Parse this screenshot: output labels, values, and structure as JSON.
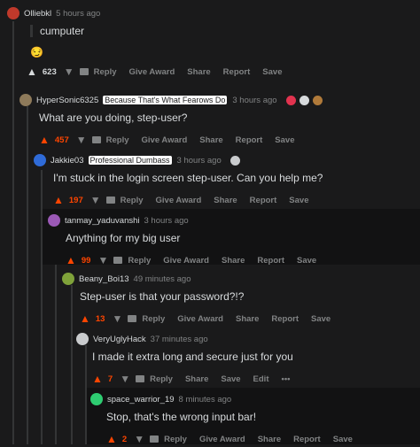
{
  "comments": [
    {
      "user": "Olliebkl",
      "time": "5 hours ago",
      "quote": "cumputer",
      "emoji": "😏",
      "score": "623",
      "actions": [
        "Reply",
        "Give Award",
        "Share",
        "Report",
        "Save"
      ]
    },
    {
      "user": "HyperSonic6325",
      "flair": "Because That's What Fearows Do",
      "time": "3 hours ago",
      "body": "What are you doing, step-user?",
      "score": "457",
      "actions": [
        "Reply",
        "Give Award",
        "Share",
        "Report",
        "Save"
      ]
    },
    {
      "user": "Jakkie03",
      "flair": "Professional Dumbass",
      "time": "3 hours ago",
      "body": "I'm stuck in the login screen step-user. Can you help me?",
      "score": "197",
      "actions": [
        "Reply",
        "Give Award",
        "Share",
        "Report",
        "Save"
      ]
    },
    {
      "user": "tanmay_yaduvanshi",
      "time": "3 hours ago",
      "body": "Anything for my big user",
      "score": "99",
      "actions": [
        "Reply",
        "Give Award",
        "Share",
        "Report",
        "Save"
      ]
    },
    {
      "user": "Beany_Boi13",
      "time": "49 minutes ago",
      "body": "Step-user is that your password?!?",
      "score": "13",
      "actions": [
        "Reply",
        "Give Award",
        "Share",
        "Report",
        "Save"
      ]
    },
    {
      "user": "VeryUglyHack",
      "time": "37 minutes ago",
      "body": "I made it extra long and secure just for you",
      "score": "7",
      "actions": [
        "Reply",
        "Share",
        "Save",
        "Edit",
        "•••"
      ]
    },
    {
      "user": "space_warrior_19",
      "time": "8 minutes ago",
      "body": "Stop, that's the wrong input bar!",
      "score": "2",
      "actions": [
        "Reply",
        "Give Award",
        "Share",
        "Report",
        "Save"
      ]
    }
  ],
  "colors": {
    "upvote": "#ff4500",
    "text": "#d7dadc",
    "muted": "#818384",
    "bg": "#1a1a1b"
  }
}
